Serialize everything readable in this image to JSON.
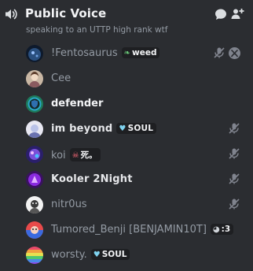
{
  "channel": {
    "title": "Public Voice",
    "subtitle": "speaking to an UTTP high rank wtf"
  },
  "icons": {
    "header_left": "voice-speaker-icon",
    "chat": "chat-bubble-icon",
    "invite": "add-member-icon",
    "muted": "mic-muted-icon",
    "xbox": "xbox-icon"
  },
  "members": [
    {
      "name": "!Fentosaurus",
      "tag": "weed",
      "tag_icon": "leaf",
      "muted": true,
      "xbox": true
    },
    {
      "name": "Cee"
    },
    {
      "name": "defender"
    },
    {
      "name": "im beyond",
      "tag": "SOUL",
      "tag_icon": "heart",
      "muted": true
    },
    {
      "name": "koi",
      "tag": "死。",
      "tag_icon": "skull",
      "muted": true
    },
    {
      "name": "Kooler 2Night",
      "muted": true
    },
    {
      "name": "nitr0us",
      "muted": true
    },
    {
      "name": "Tumored_Benji [BENJAMIN10T]",
      "tag": ":3",
      "tag_icon": "cat"
    },
    {
      "name": "worsty.",
      "tag": "SOUL",
      "tag_icon": "heart"
    }
  ],
  "colors": {
    "background": "#2b2d31",
    "text_muted": "#949ba4",
    "text_bright": "#f2f3f5",
    "tag_bg": "#1e1f22"
  }
}
